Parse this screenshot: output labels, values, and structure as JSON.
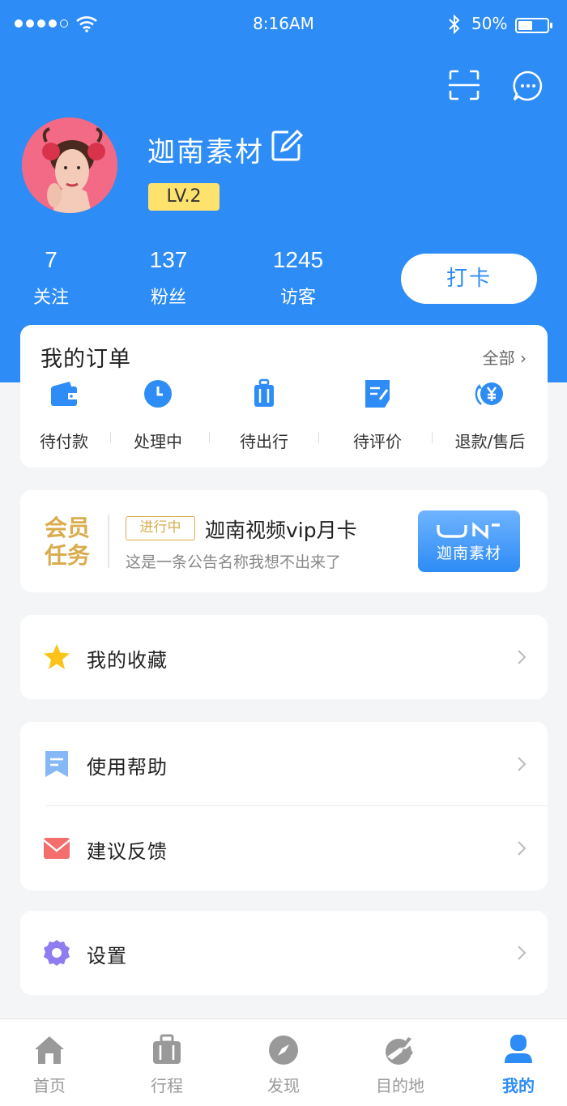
{
  "status_bar": {
    "time": "8:16AM",
    "battery": "50%",
    "battery_level": 0.5
  },
  "profile": {
    "name": "迦南素材",
    "level": "LV.2"
  },
  "stats": [
    {
      "value": "7",
      "label": "关注"
    },
    {
      "value": "137",
      "label": "粉丝"
    },
    {
      "value": "1245",
      "label": "访客"
    }
  ],
  "checkin_label": "打卡",
  "orders": {
    "title": "我的订单",
    "all_label": "全部",
    "items": [
      {
        "label": "待付款",
        "icon": "wallet-icon"
      },
      {
        "label": "处理中",
        "icon": "clock-icon"
      },
      {
        "label": "待出行",
        "icon": "luggage-icon"
      },
      {
        "label": "待评价",
        "icon": "review-icon"
      },
      {
        "label": "退款/售后",
        "icon": "refund-icon"
      }
    ]
  },
  "vip": {
    "title": "会员任务",
    "badge": "进行中",
    "name": "迦南视频vip月卡",
    "notice": "这是一条公告名称我想不出来了",
    "logo_text": "迦南素材"
  },
  "menu": {
    "favorites": "我的收藏",
    "help": "使用帮助",
    "feedback": "建议反馈",
    "settings": "设置"
  },
  "tabs": [
    {
      "label": "首页",
      "icon": "home-icon"
    },
    {
      "label": "行程",
      "icon": "suitcase-icon"
    },
    {
      "label": "发现",
      "icon": "compass-icon"
    },
    {
      "label": "目的地",
      "icon": "plane-icon"
    },
    {
      "label": "我的",
      "icon": "user-icon"
    }
  ],
  "colors": {
    "primary": "#2d8cf5",
    "gold": "#d9ac4c",
    "level_badge": "#fde26e"
  }
}
